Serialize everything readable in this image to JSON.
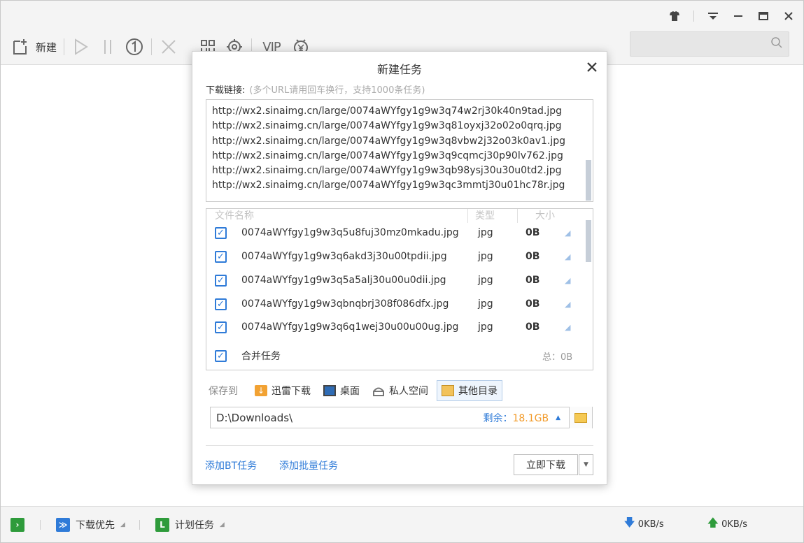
{
  "toolbar": {
    "new_label": "新建",
    "vip_label": "VIP"
  },
  "dialog": {
    "title": "新建任务",
    "url_label": "下载链接:",
    "url_hint": "(多个URL请用回车换行，支持1000条任务)",
    "urls": [
      "http://wx2.sinaimg.cn/large/0074aWYfgy1g9w3q74w2rj30k40n9tad.jpg",
      "http://wx2.sinaimg.cn/large/0074aWYfgy1g9w3q81oyxj32o02o0qrq.jpg",
      "http://wx2.sinaimg.cn/large/0074aWYfgy1g9w3q8vbw2j32o03k0av1.jpg",
      "http://wx2.sinaimg.cn/large/0074aWYfgy1g9w3q9cqmcj30p90lv762.jpg",
      "http://wx2.sinaimg.cn/large/0074aWYfgy1g9w3qb98ysj30u30u0td2.jpg",
      "http://wx2.sinaimg.cn/large/0074aWYfgy1g9w3qc3mmtj30u01hc78r.jpg"
    ],
    "table_headers": {
      "name": "文件名称",
      "type": "类型",
      "size": "大小"
    },
    "files": [
      {
        "name": "0074aWYfgy1g9w3q5u8fuj30mz0mkadu.jpg",
        "type": "jpg",
        "size": "0B",
        "checked": true
      },
      {
        "name": "0074aWYfgy1g9w3q6akd3j30u00tpdii.jpg",
        "type": "jpg",
        "size": "0B",
        "checked": true
      },
      {
        "name": "0074aWYfgy1g9w3q5a5alj30u00u0dii.jpg",
        "type": "jpg",
        "size": "0B",
        "checked": true
      },
      {
        "name": "0074aWYfgy1g9w3qbnqbrj308f086dfx.jpg",
        "type": "jpg",
        "size": "0B",
        "checked": true
      },
      {
        "name": "0074aWYfgy1g9w3q6q1wej30u00u00ug.jpg",
        "type": "jpg",
        "size": "0B",
        "checked": true
      }
    ],
    "merge_label": "合并任务",
    "merge_checked": true,
    "total": "总：0B",
    "save_to_label": "保存到",
    "locations": [
      "迅雷下载",
      "桌面",
      "私人空间",
      "其他目录"
    ],
    "active_location": "其他目录",
    "path": "D:\\Downloads\\",
    "free_label": "剩余：",
    "free_value": "18.1GB",
    "add_bt_label": "添加BT任务",
    "add_batch_label": "添加批量任务",
    "download_now_label": "立即下载"
  },
  "statusbar": {
    "priority_label": "下载优先",
    "schedule_label": "计划任务",
    "down_speed": "0KB/s",
    "up_speed": "0KB/s"
  },
  "colors": {
    "accent": "#2f7bd8",
    "green": "#2e9b3b",
    "orange": "#f29a28"
  }
}
